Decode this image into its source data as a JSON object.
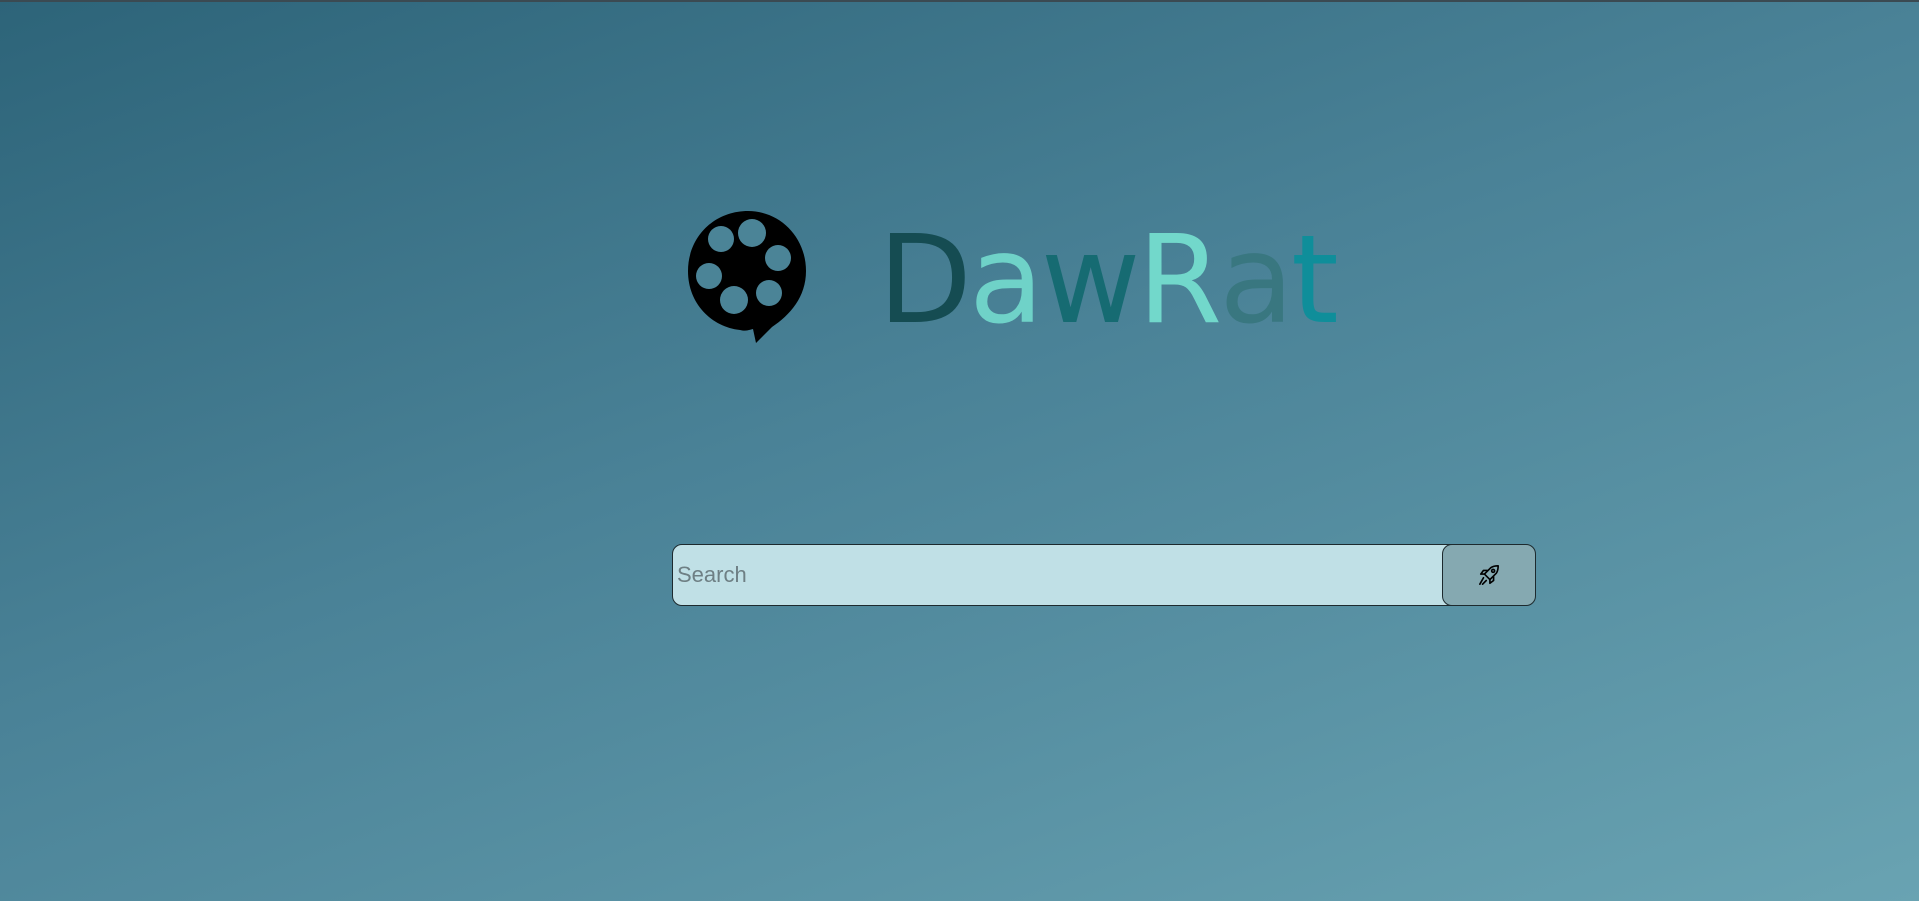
{
  "brand": {
    "letters": [
      {
        "char": "D",
        "color": "#154c52"
      },
      {
        "char": "a",
        "color": "#6fd2c8"
      },
      {
        "char": "w",
        "color": "#166b72"
      },
      {
        "char": "R",
        "color": "#72d8cb"
      },
      {
        "char": "a",
        "color": "#397780"
      },
      {
        "char": "t",
        "color": "#0f8e9a"
      }
    ],
    "logo_icon": "film-reel-speech-bubble-icon"
  },
  "search": {
    "placeholder": "Search",
    "value": "",
    "button_icon": "rocket-icon"
  },
  "colors": {
    "background_start": "#2d6479",
    "background_end": "#69a3b2",
    "input_background": "#c0e0e6",
    "button_background": "#85a9b1"
  }
}
